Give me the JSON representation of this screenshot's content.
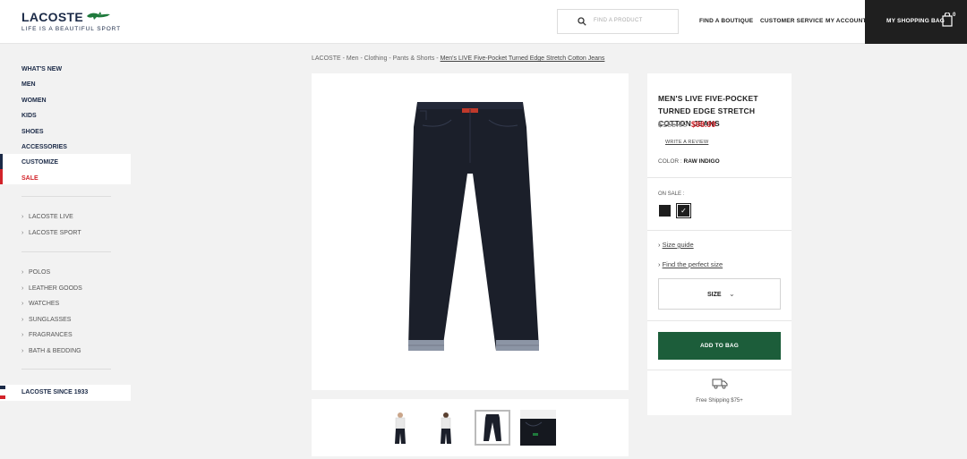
{
  "header": {
    "logo_word": "LACOSTE",
    "logo_tagline": "LIFE IS A BEAUTIFUL SPORT",
    "search_placeholder": "FIND A PRODUCT",
    "nav": [
      "FIND A BOUTIQUE",
      "CUSTOMER SERVICE",
      "MY ACCOUNT"
    ],
    "bag_label": "MY SHOPPING BAG",
    "bag_count": "0"
  },
  "sidebar": {
    "main": [
      "WHAT'S NEW",
      "MEN",
      "WOMEN",
      "KIDS",
      "SHOES",
      "ACCESSORIES",
      "CUSTOMIZE",
      "SALE"
    ],
    "lines": [
      "LACOSTE LIVE",
      "LACOSTE SPORT"
    ],
    "categories": [
      "POLOS",
      "LEATHER GOODS",
      "WATCHES",
      "SUNGLASSES",
      "FRAGRANCES",
      "BATH & BEDDING"
    ],
    "since": "LACOSTE SINCE 1933"
  },
  "breadcrumb": {
    "trail": "LACOSTE - Men - Clothing - Pants & Shorts - ",
    "current": "Men's LIVE Five-Pocket Turned Edge Stretch Cotton Jeans"
  },
  "product": {
    "title": "MEN'S LIVE FIVE-POCKET TURNED EDGE STRETCH COTTON JEANS",
    "old_price": "$165.00",
    "price": "$98.99",
    "review": "WRITE A REVIEW",
    "color_label": "COLOR :",
    "color_value": "RAW INDIGO",
    "on_sale": "ON SALE :",
    "size_guide": "Size guide",
    "perfect_size": "Find the perfect size",
    "size": "SIZE",
    "add_to_bag": "ADD TO BAG",
    "shipping": "Free Shipping $75+"
  },
  "colors": {
    "brand_navy": "#1b2a47",
    "sale_red": "#d2232a",
    "add_to_bag_green": "#1c5d3a"
  }
}
